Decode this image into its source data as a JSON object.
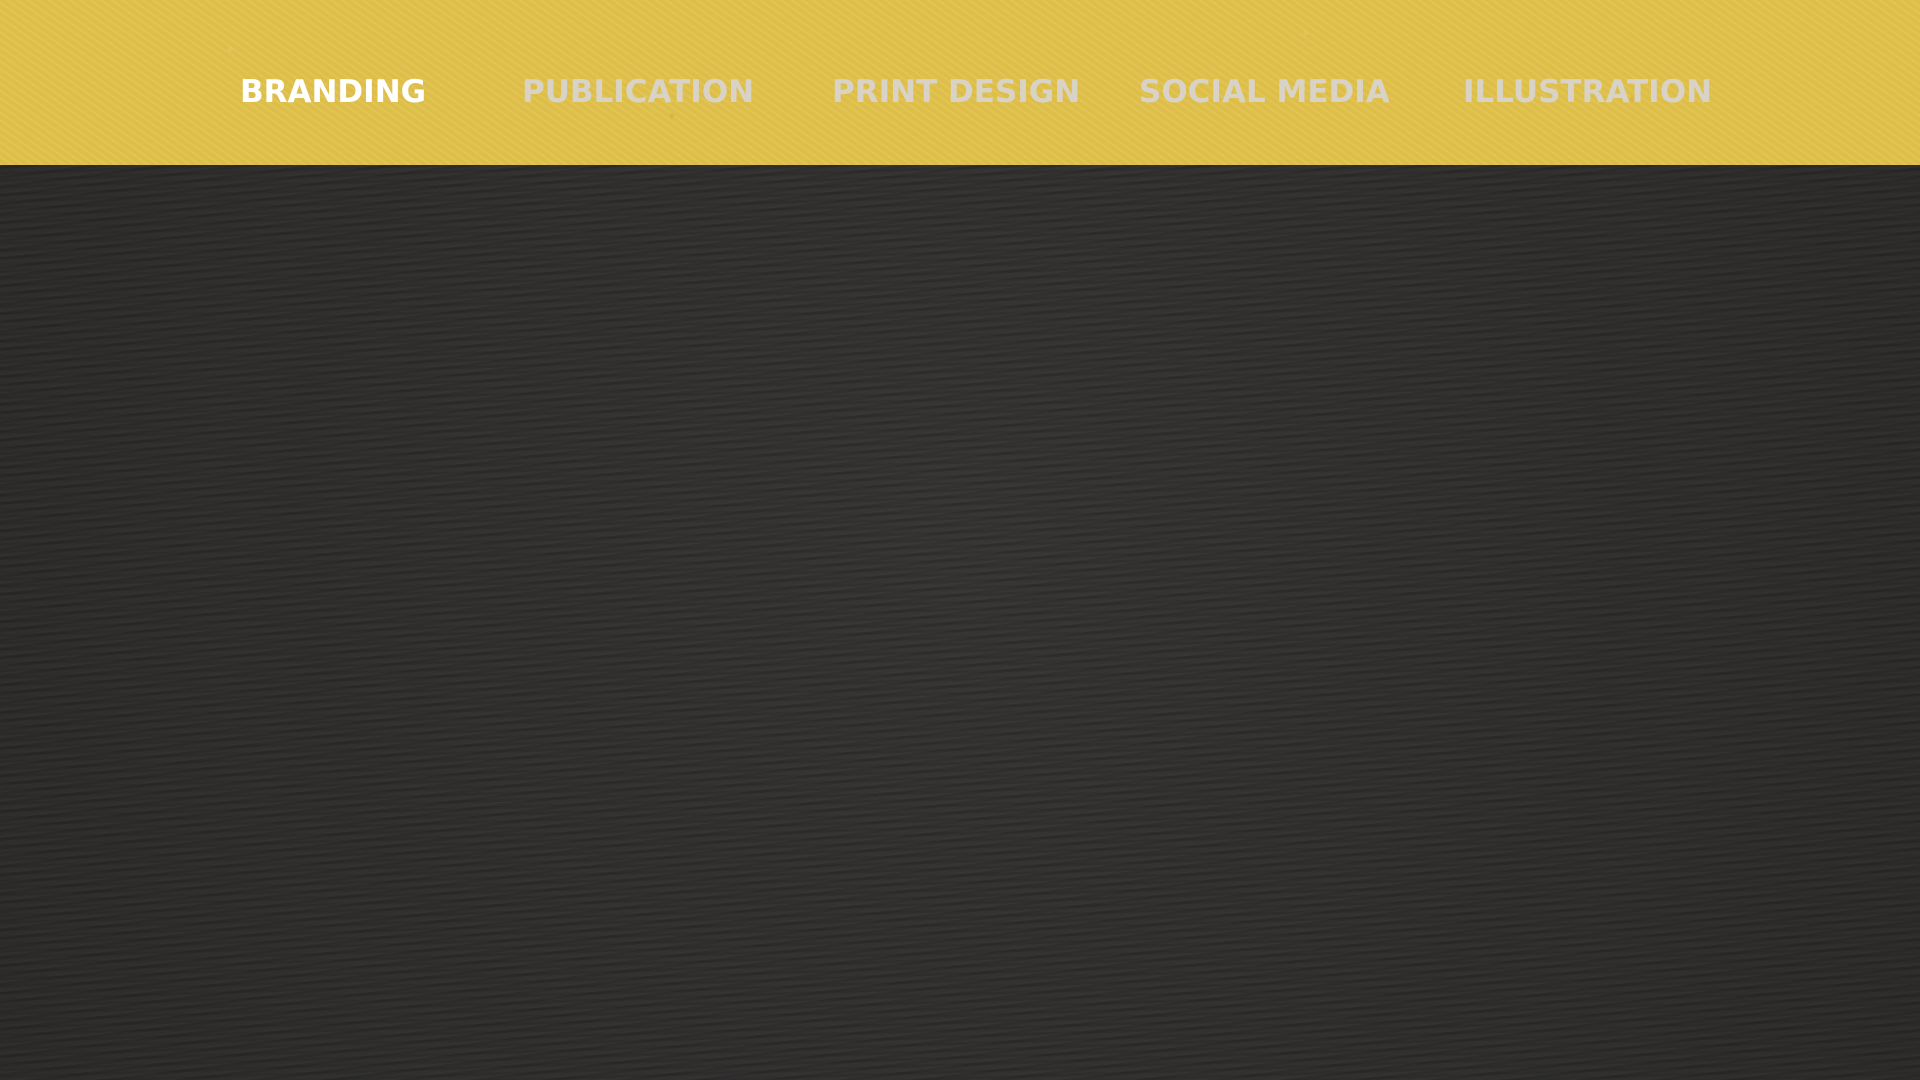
{
  "nav": {
    "items": [
      {
        "label": "BRANDING",
        "active": true
      },
      {
        "label": "PUBLICATION",
        "active": false
      },
      {
        "label": "PRINT DESIGN",
        "active": false
      },
      {
        "label": "SOCIAL MEDIA",
        "active": false
      },
      {
        "label": "ILLUSTRATION",
        "active": false
      }
    ]
  },
  "colors": {
    "header_background": "#e1c24c",
    "content_background": "#2f2d2b",
    "active_text": "#ffffff",
    "inactive_text": "#d8d3c6"
  }
}
